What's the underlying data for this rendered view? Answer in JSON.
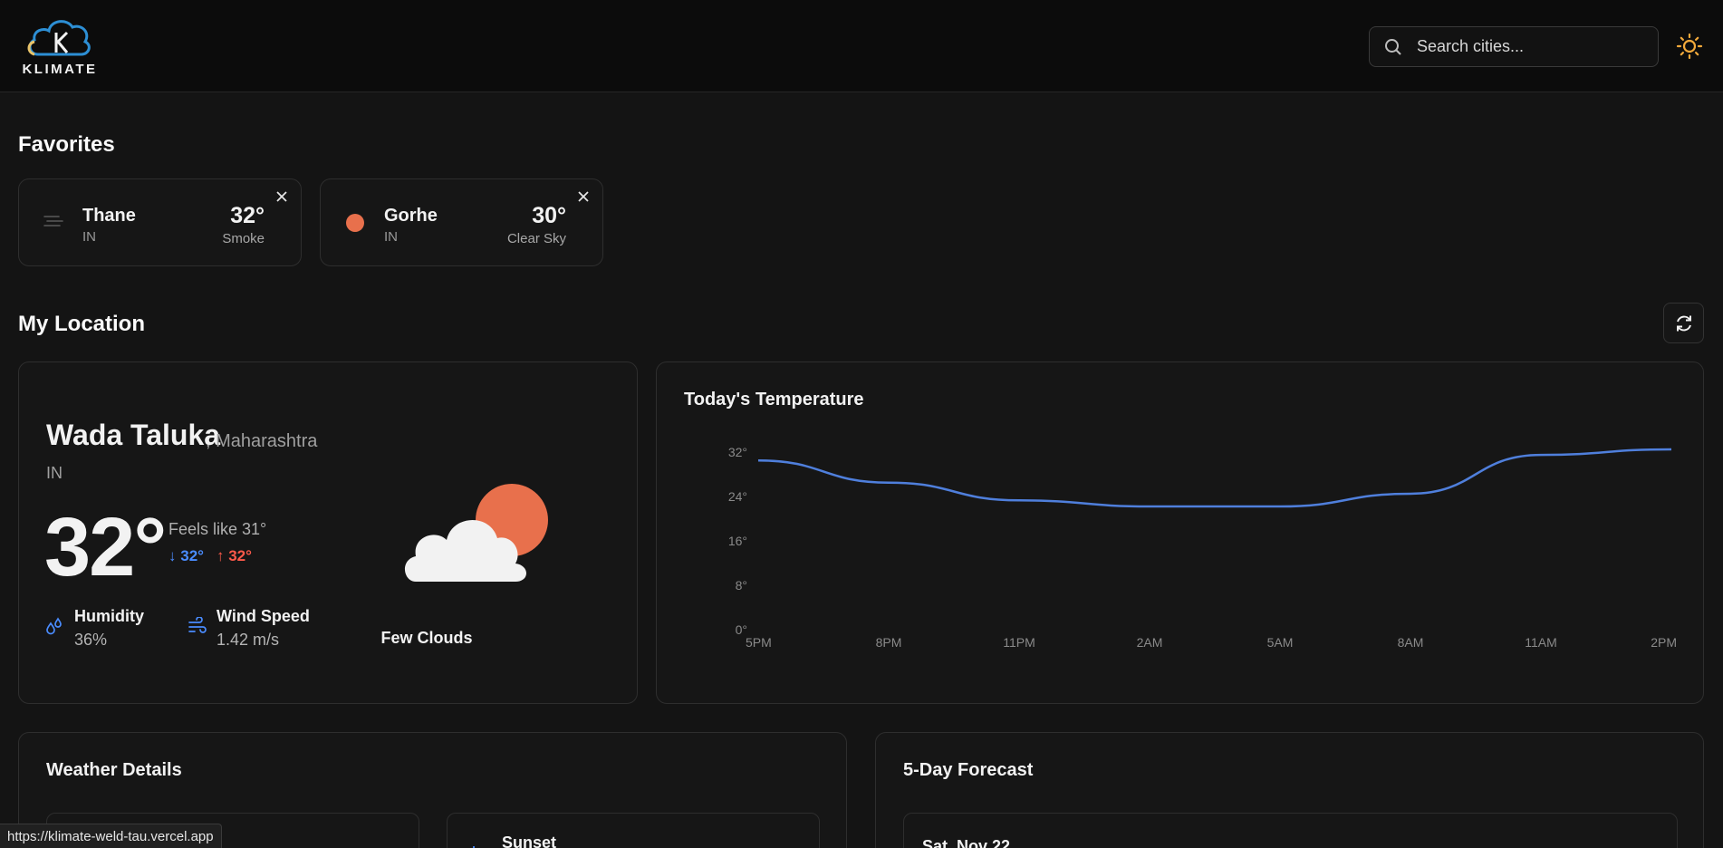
{
  "app": {
    "logo_text": "KLIMATE",
    "accent": "#f2a93b"
  },
  "search": {
    "placeholder": "Search cities..."
  },
  "favorites": {
    "title": "Favorites",
    "items": [
      {
        "name": "Thane",
        "country": "IN",
        "temp": "32°",
        "condition": "Smoke",
        "icon": "haze-icon"
      },
      {
        "name": "Gorhe",
        "country": "IN",
        "temp": "30°",
        "condition": "Clear Sky",
        "icon": "sun-icon"
      }
    ]
  },
  "my_location": {
    "title": "My Location",
    "city": "Wada Taluka",
    "state": ", Maharashtra",
    "country": "IN",
    "temp": "32°",
    "feels_like": "Feels like 31°",
    "min": "32°",
    "max": "32°",
    "humidity_label": "Humidity",
    "humidity_value": "36%",
    "wind_label": "Wind Speed",
    "wind_value": "1.42 m/s",
    "condition": "Few Clouds"
  },
  "temperature_chart": {
    "title": "Today's Temperature"
  },
  "chart_data": {
    "type": "line",
    "title": "Today's Temperature",
    "x": [
      "5PM",
      "8PM",
      "11PM",
      "2AM",
      "5AM",
      "8AM",
      "11AM",
      "2PM"
    ],
    "values": [
      30.5,
      26.5,
      23.3,
      22.2,
      22.2,
      24.5,
      31.5,
      32.5
    ],
    "yticks": [
      "0°",
      "8°",
      "16°",
      "24°",
      "32°"
    ],
    "ylim": [
      0,
      32
    ],
    "line_color": "#4f7fdc",
    "grid": false
  },
  "weather_details": {
    "title": "Weather Details",
    "sunset_label": "Sunset"
  },
  "forecast": {
    "title": "5-Day Forecast",
    "first_day": "Sat, Nov 22"
  },
  "status_url": "https://klimate-weld-tau.vercel.app"
}
